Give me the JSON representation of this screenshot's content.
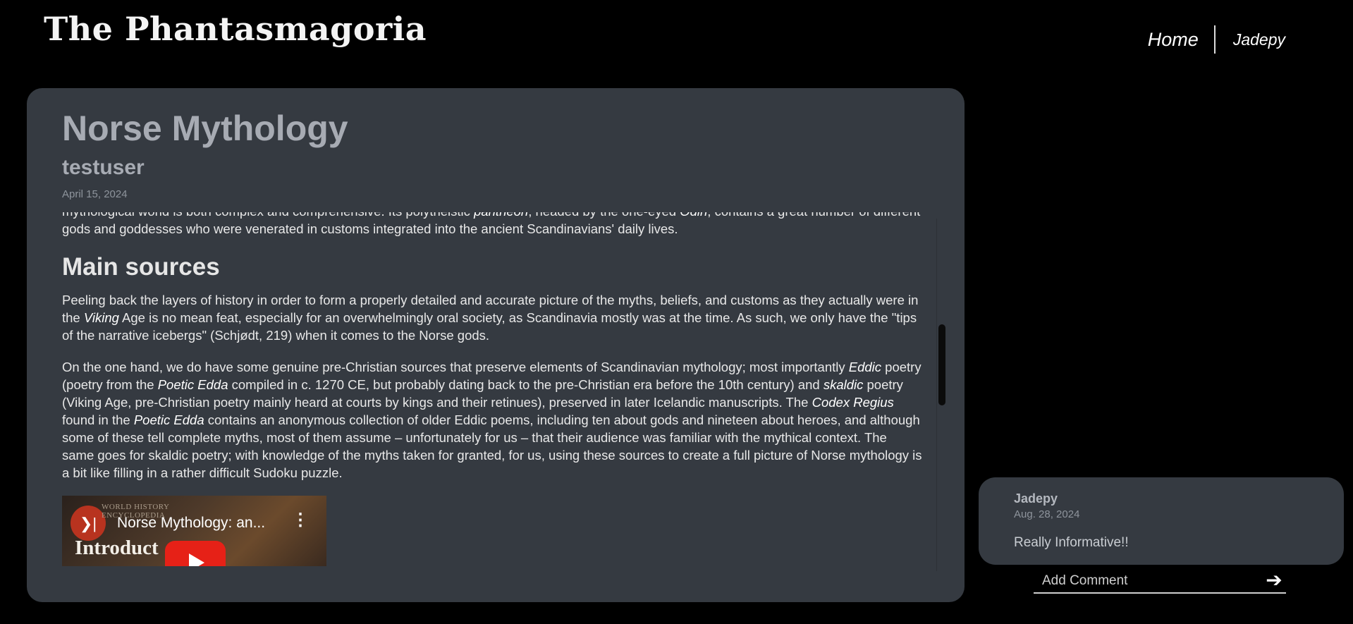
{
  "site": {
    "title": "The Phantasmagoria"
  },
  "nav": {
    "home": "Home",
    "user": "Jadepy"
  },
  "post": {
    "title": "Norse Mythology",
    "author": "testuser",
    "date": "April 15, 2024",
    "intro": {
      "p1_a": "mythological world is both complex and comprehensive. Its polytheistic ",
      "p1_b": "pantheon",
      "p1_c": ", headed by the one-eyed ",
      "p1_d": "Odin",
      "p1_e": ", contains a great number of different gods and goddesses who were venerated in customs integrated into the ancient Scandinavians' daily lives."
    },
    "section_heading": "Main sources",
    "para2": {
      "a": "Peeling back the layers of history in order to form a properly detailed and accurate picture of the myths, beliefs, and customs as they actually were in the ",
      "b": "Viking",
      "c": " Age is no mean feat, especially for an overwhelmingly oral society, as Scandinavia mostly was at the time. As such, we only have the \"tips of the narrative icebergs\" (Schjødt, 219) when it comes to the Norse gods."
    },
    "para3": {
      "a": "On the one hand, we do have some genuine pre-Christian sources that preserve elements of Scandinavian mythology; most importantly ",
      "b": "Eddic",
      "c": " poetry (poetry from the ",
      "d": "Poetic ",
      "e": "Edda",
      "f": " compiled in c. 1270 CE, but probably dating back to the pre-Christian era before the 10th century) and ",
      "g": "skaldic",
      "h": " poetry (Viking Age, pre-Christian poetry mainly heard at courts by kings and their retinues), preserved in later Icelandic manuscripts. The ",
      "i": "Codex Regius",
      "j": " found in the ",
      "k": "Poetic Edda",
      "l": " contains an anonymous collection of older Eddic poems, including ten about gods and nineteen about heroes, and although some of these tell complete myths, most of them assume – unfortunately for us – that their audience was familiar with the mythical context. The same goes for skaldic poetry; with knowledge of the myths taken for granted, for us, using these sources to create a full picture of Norse mythology is a bit like filling in a rather difficult Sudoku puzzle."
    },
    "video": {
      "brand_line1": "WORLD HISTORY",
      "brand_line2": "ENCYCLOPEDIA",
      "title": "Norse Mythology: an...",
      "more": "⋮",
      "overlay": "Introduct",
      "logo_icon": "world-history-logo-icon",
      "play_icon": "play-icon"
    }
  },
  "comments": [
    {
      "author": "Jadepy",
      "date": "Aug. 28, 2024",
      "text": "Really Informative!!"
    }
  ],
  "comment_form": {
    "placeholder": "Add Comment",
    "send_icon": "arrow-right-icon"
  },
  "colors": {
    "background": "#000000",
    "card": "#353a41",
    "title": "#a7abb3"
  }
}
